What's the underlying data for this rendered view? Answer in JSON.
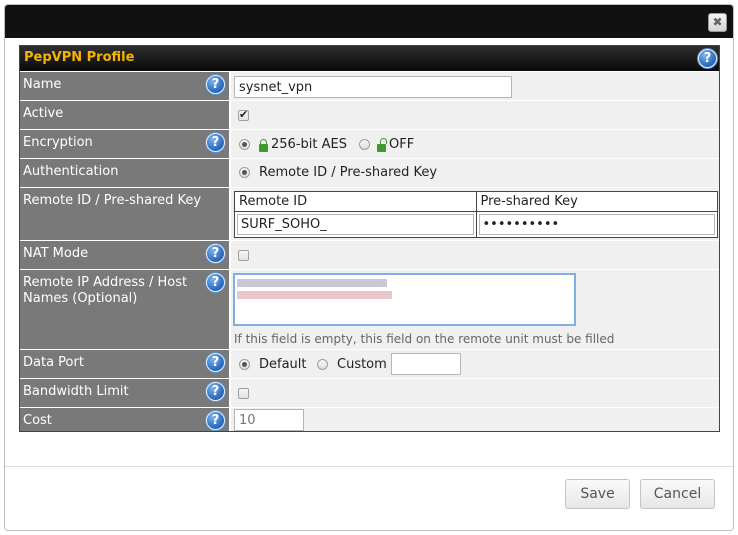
{
  "dialog": {
    "close_icon": "close-icon"
  },
  "profile": {
    "title": "PepVPN Profile",
    "help_glyph": "?"
  },
  "rows": {
    "name": {
      "label": "Name",
      "value": "sysnet_vpn"
    },
    "active": {
      "label": "Active",
      "checked": true
    },
    "encryption": {
      "label": "Encryption",
      "option_aes": "256-bit AES",
      "option_off": "OFF",
      "selected": "256-bit AES"
    },
    "authentication": {
      "label": "Authentication",
      "option": "Remote ID / Pre-shared Key"
    },
    "remote_id_psk": {
      "label": "Remote ID / Pre-shared Key",
      "col_remote_id": "Remote ID",
      "col_psk": "Pre-shared Key",
      "remote_id_value": "SURF_SOHO_",
      "psk_value": "••••••••••"
    },
    "nat_mode": {
      "label": "NAT Mode",
      "checked": false
    },
    "remote_ip": {
      "label": "Remote IP Address / Host Names (Optional)",
      "hint": "If this field is empty, this field on the remote unit must be filled"
    },
    "data_port": {
      "label": "Data Port",
      "option_default": "Default",
      "option_custom": "Custom",
      "selected": "Default",
      "custom_value": ""
    },
    "bandwidth_limit": {
      "label": "Bandwidth Limit",
      "checked": false
    },
    "cost": {
      "label": "Cost",
      "value": "10"
    }
  },
  "footer": {
    "save_label": "Save",
    "cancel_label": "Cancel"
  },
  "colors": {
    "title_bar": "#111111",
    "header_text": "#f6b400",
    "label_bg": "#797979",
    "value_bg": "#f0f0f0",
    "help_icon": "#2f6fc3",
    "lock_icon": "#3f9a2e"
  }
}
